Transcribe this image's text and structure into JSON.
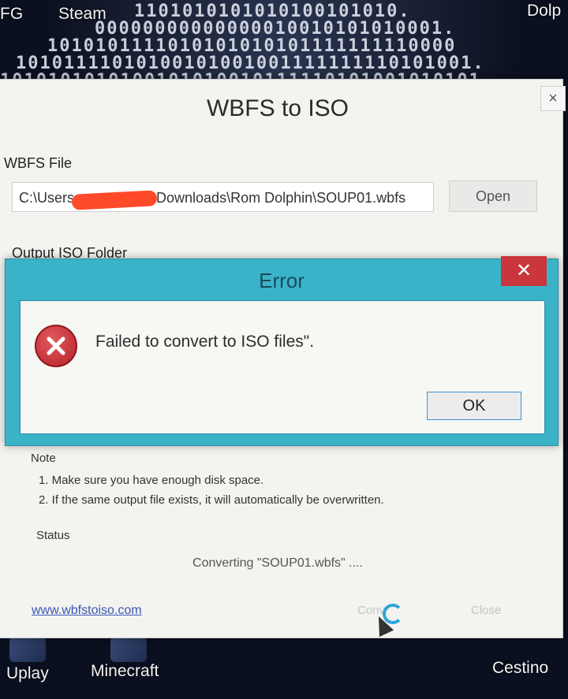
{
  "desktop": {
    "top_labels": [
      "FG",
      "Steam",
      "Dolp"
    ],
    "bottom_labels": [
      "Uplay",
      "Minecraft",
      "Cestino"
    ],
    "binary_lines": [
      "1101010101010100101010.",
      "00000000000000010010101010001.",
      "1010101111010101010101111111110000",
      "10101111010100101001001111111110101001.",
      "1010101010100101010010111110101001010101"
    ]
  },
  "main_window": {
    "title": "WBFS to ISO",
    "close_glyph": "×",
    "wbfs_file_label": "WBFS File",
    "wbfs_path_prefix": "C:\\Users",
    "wbfs_path_suffix": "Downloads\\Rom Dolphin\\SOUP01.wbfs",
    "open_button": "Open",
    "output_folder_label": "Output ISO Folder",
    "note_label": "Note",
    "notes": [
      "1. Make sure you have enough disk space.",
      "2. If the same output file exists, it will automatically be overwritten."
    ],
    "status_label": "Status",
    "status_text": "Converting \"SOUP01.wbfs\" ....",
    "website_link": "www.wbfstoiso.com",
    "convert_button": "Conv",
    "close_button": "Close"
  },
  "error_dialog": {
    "title": "Error",
    "close_glyph": "✕",
    "message": "Failed to convert to ISO files\".",
    "ok_button": "OK"
  },
  "colors": {
    "dialog_border": "#3ab3c9",
    "close_red": "#c9363b",
    "error_icon_red": "#c8262d",
    "redaction": "#ff4a2a"
  }
}
